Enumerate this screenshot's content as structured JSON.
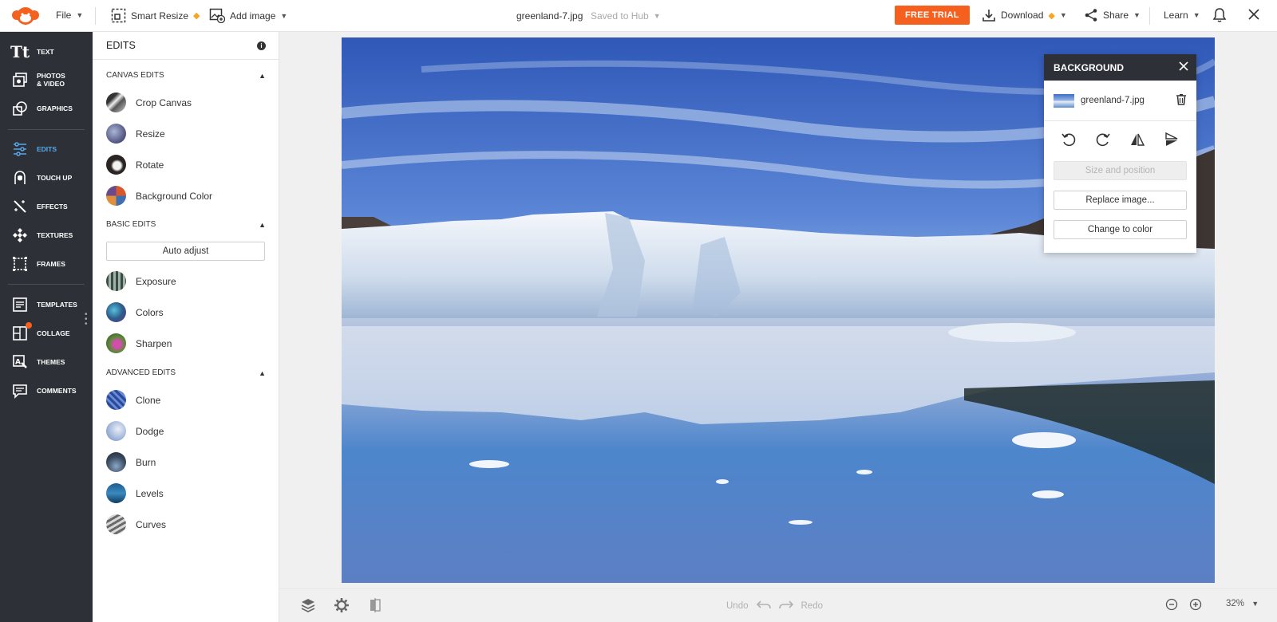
{
  "topbar": {
    "file_label": "File",
    "smart_resize_label": "Smart Resize",
    "add_image_label": "Add image",
    "doc_title": "greenland-7.jpg",
    "save_status": "Saved to Hub",
    "free_trial_label": "FREE TRIAL",
    "download_label": "Download",
    "share_label": "Share",
    "learn_label": "Learn"
  },
  "rail": {
    "items": [
      {
        "label": "TEXT",
        "icon": "text-icon"
      },
      {
        "label": "PHOTOS\n& VIDEO",
        "icon": "photos-icon"
      },
      {
        "label": "GRAPHICS",
        "icon": "graphics-icon"
      },
      {
        "label": "EDITS",
        "icon": "sliders-icon",
        "active": true
      },
      {
        "label": "TOUCH UP",
        "icon": "face-icon"
      },
      {
        "label": "EFFECTS",
        "icon": "magic-wand-icon"
      },
      {
        "label": "TEXTURES",
        "icon": "texture-icon"
      },
      {
        "label": "FRAMES",
        "icon": "frame-icon"
      },
      {
        "label": "TEMPLATES",
        "icon": "template-icon"
      },
      {
        "label": "COLLAGE",
        "icon": "collage-icon"
      },
      {
        "label": "THEMES",
        "icon": "themes-icon"
      },
      {
        "label": "COMMENTS",
        "icon": "comment-icon"
      }
    ]
  },
  "panel": {
    "title": "EDITS",
    "canvas_edits": {
      "title": "CANVAS EDITS",
      "items": [
        "Crop Canvas",
        "Resize",
        "Rotate",
        "Background Color"
      ]
    },
    "basic_edits": {
      "title": "BASIC EDITS",
      "auto_adjust": "Auto adjust",
      "items": [
        "Exposure",
        "Colors",
        "Sharpen"
      ]
    },
    "advanced_edits": {
      "title": "ADVANCED EDITS",
      "items": [
        "Clone",
        "Dodge",
        "Burn",
        "Levels",
        "Curves"
      ]
    }
  },
  "background_panel": {
    "title": "BACKGROUND",
    "filename": "greenland-7.jpg",
    "size_position_label": "Size and position",
    "replace_label": "Replace image...",
    "change_color_label": "Change to color"
  },
  "bottombar": {
    "undo_label": "Undo",
    "redo_label": "Redo",
    "zoom_level": "32%"
  },
  "colors": {
    "accent": "#f6601e",
    "rail_bg": "#2d3137",
    "active_blue": "#56a9ea"
  }
}
